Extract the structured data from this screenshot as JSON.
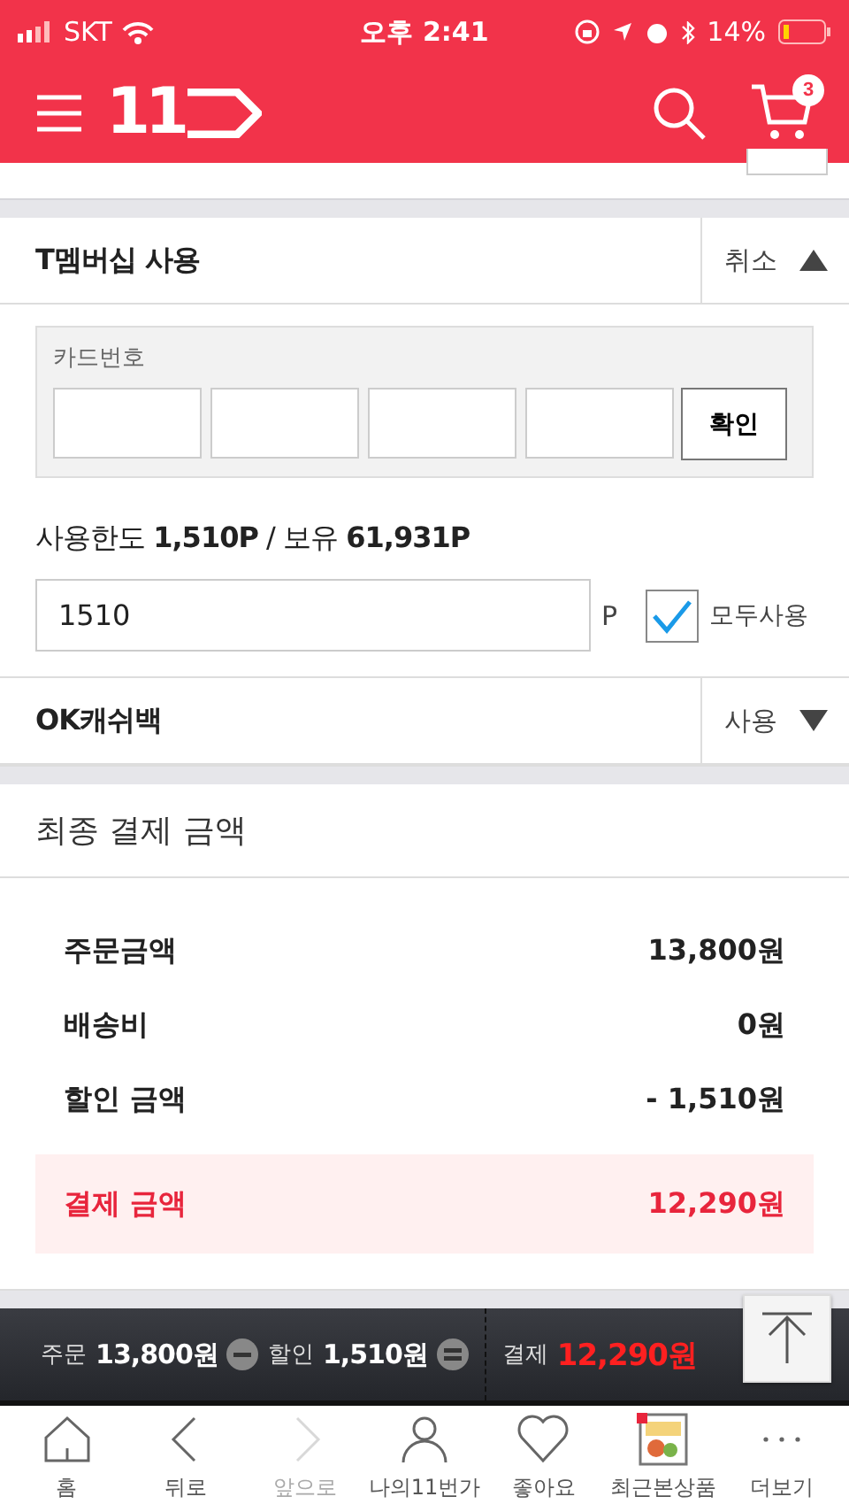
{
  "status_bar": {
    "carrier": "SKT",
    "time": "오후 2:41",
    "battery": "14%"
  },
  "header": {
    "logo": "11",
    "cart_count": "3"
  },
  "sections": [
    {
      "kind": "tmembership",
      "title": "T멤버십 사용",
      "action": "취소",
      "expanded": true,
      "card_label": "카드번호",
      "confirm": "확인",
      "usage": "사용한도 **1,510P** / 보유 **61,931P**",
      "points_value": "1510",
      "points_unit": "P",
      "use_all": "모두사용",
      "use_all_checked": true
    },
    {
      "kind": "okcashbag",
      "title": "OK캐쉬백",
      "action": "사용",
      "expanded": false
    }
  ],
  "final": {
    "title": "최종 결제 금액",
    "rows": [
      {
        "label": "주문금액",
        "value": "13,800원",
        "kind": "normal"
      },
      {
        "label": "배송비",
        "value": "0원",
        "kind": "normal"
      },
      {
        "label": "할인 금액",
        "value": "- 1,510원",
        "kind": "normal"
      },
      {
        "label": "결제 금액",
        "value": "12,290원",
        "kind": "total"
      }
    ]
  },
  "summary_bar": {
    "items": [
      {
        "label": "주문",
        "value": "13,800원",
        "kind": "normal"
      },
      {
        "label": "할인",
        "value": "1,510원",
        "kind": "minus"
      },
      {
        "label": "결제",
        "value": "12,290원",
        "kind": "equals"
      }
    ]
  },
  "nav": [
    {
      "label": "홈",
      "kind": "home",
      "disabled": false
    },
    {
      "label": "뒤로",
      "kind": "back",
      "disabled": false
    },
    {
      "label": "앞으로",
      "kind": "forward",
      "disabled": true
    },
    {
      "label": "나의11번가",
      "kind": "my",
      "disabled": false
    },
    {
      "label": "좋아요",
      "kind": "heart",
      "disabled": false
    },
    {
      "label": "최근본상품",
      "kind": "thumb",
      "disabled": false
    },
    {
      "label": "더보기",
      "kind": "more",
      "disabled": false
    }
  ]
}
